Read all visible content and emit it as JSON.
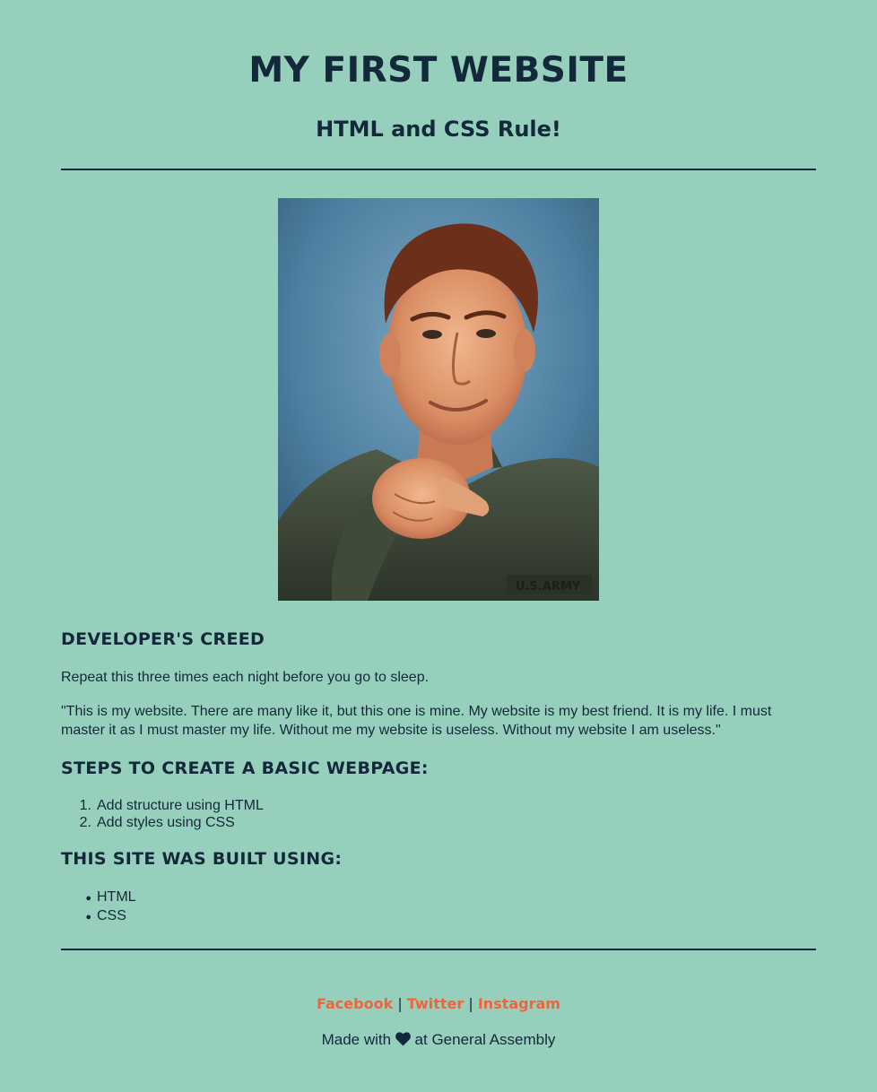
{
  "header": {
    "title": "MY FIRST WEBSITE",
    "tagline": "HTML and CSS Rule!"
  },
  "photo": {
    "icon": "portrait-photo"
  },
  "creed": {
    "heading": "DEVELOPER'S CREED",
    "intro": "Repeat this three times each night before you go to sleep.",
    "quote": "\"This is my website. There are many like it, but this one is mine. My website is my best friend. It is my life. I must master it as I must master my life. Without me my website is useless. Without my website I am useless.\""
  },
  "steps": {
    "heading": "STEPS TO CREATE A BASIC WEBPAGE:",
    "items": [
      {
        "num": "1.",
        "label": "Add structure using HTML"
      },
      {
        "num": "2.",
        "label": "Add styles using CSS"
      }
    ]
  },
  "built": {
    "heading": "THIS SITE WAS BUILT USING:",
    "items": [
      {
        "bullet": "●",
        "label": "HTML"
      },
      {
        "bullet": "●",
        "label": "CSS"
      }
    ]
  },
  "footer": {
    "links": [
      {
        "label": "Facebook"
      },
      {
        "label": "Twitter"
      },
      {
        "label": "Instagram"
      }
    ],
    "separator": "|",
    "made_prefix": "Made with",
    "made_icon": "heart-icon",
    "made_suffix": "at General Assembly"
  },
  "colors": {
    "background": "#96d0bc",
    "text": "#13283b",
    "link": "#f0633c"
  }
}
